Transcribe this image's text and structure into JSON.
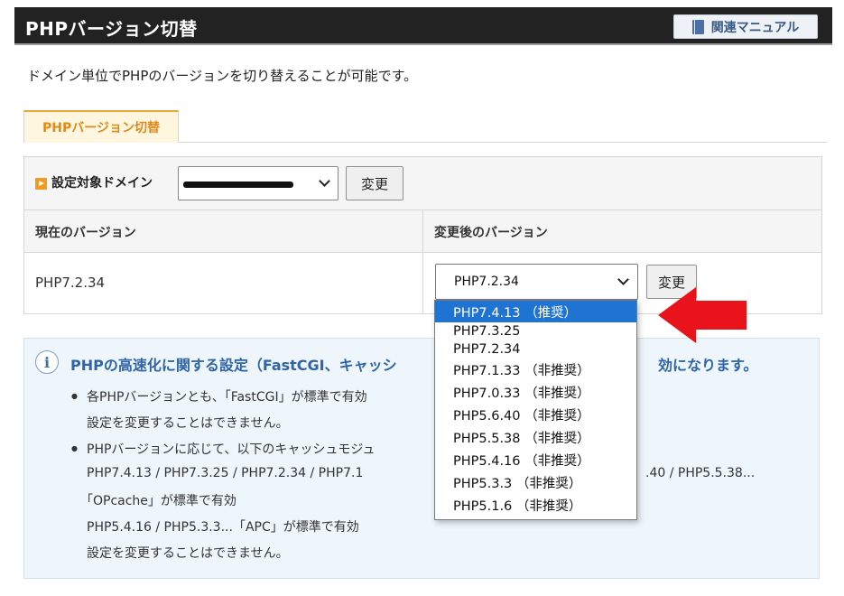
{
  "header": {
    "title": "PHPバージョン切替",
    "manual_label": "関連マニュアル"
  },
  "intro": "ドメイン単位でPHPのバージョンを切り替えることが可能です。",
  "tab": {
    "label": "PHPバージョン切替"
  },
  "form": {
    "domain_label": "設定対象ドメイン",
    "change_label": "変更",
    "current_header": "現在のバージョン",
    "after_header": "変更後のバージョン",
    "current_version": "PHP7.2.34",
    "selected_version": "PHP7.2.34"
  },
  "info": {
    "title": "PHPの高速化に関する設定（FastCGI、キャッシ",
    "title_tail": "効になります。",
    "bullet1_line1": "各PHPバージョンとも、「FastCGI」が標準で有効",
    "bullet1_line2": "設定を変更することはできません。",
    "bullet2_line1": "PHPバージョンに応じて、以下のキャッシュモジュ",
    "bullet2_line2_left": "PHP7.4.13 / PHP7.3.25 / PHP7.2.34 / PHP7.1",
    "bullet2_line2_right": ".40 / PHP5.5.38...",
    "bullet2_line3": "「OPcache」が標準で有効",
    "bullet2_line4": "PHP5.4.16 / PHP5.3.3...「APC」が標準で有効",
    "bullet2_line5": "設定を変更することはできません。"
  },
  "dropdown": {
    "options": [
      "PHP7.4.13 （推奨）",
      "PHP7.3.25",
      "PHP7.2.34",
      "PHP7.1.33 （非推奨）",
      "PHP7.0.33 （非推奨）",
      "PHP5.6.40 （非推奨）",
      "PHP5.5.38 （非推奨）",
      "PHP5.4.16 （非推奨）",
      "PHP5.3.3 （非推奨）",
      "PHP5.1.6 （非推奨）"
    ],
    "highlighted": "PHP7.4.13 （推奨）"
  },
  "colors": {
    "header_bg": "#222222",
    "tab_accent": "#e08a1a",
    "info_title": "#2f64a6",
    "highlight": "#1f73d2",
    "arrow": "#e8131b"
  },
  "icons": [
    "book-icon",
    "orange-arrow-icon",
    "chevron-down-icon",
    "info-icon",
    "red-arrow-icon"
  ]
}
